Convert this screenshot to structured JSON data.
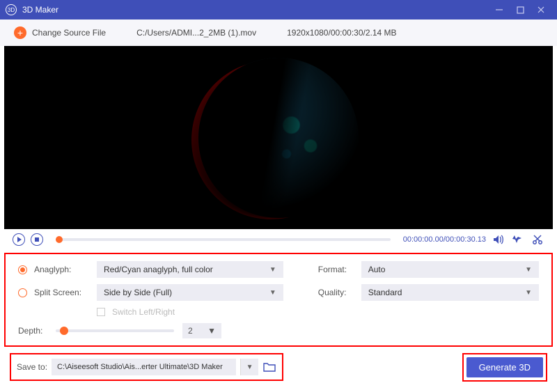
{
  "titlebar": {
    "title": "3D Maker"
  },
  "toolbar": {
    "change_label": "Change Source File",
    "path": "C:/Users/ADMI...2_2MB (1).mov",
    "info": "1920x1080/00:00:30/2.14 MB"
  },
  "playback": {
    "current": "00:00:00.00",
    "total": "/00:00:30.13"
  },
  "options": {
    "anaglyph_label": "Anaglyph:",
    "anaglyph_value": "Red/Cyan anaglyph, full color",
    "split_label": "Split Screen:",
    "split_value": "Side by Side (Full)",
    "switch_label": "Switch Left/Right",
    "depth_label": "Depth:",
    "depth_value": "2",
    "format_label": "Format:",
    "format_value": "Auto",
    "quality_label": "Quality:",
    "quality_value": "Standard"
  },
  "footer": {
    "save_label": "Save to:",
    "save_path": "C:\\Aiseesoft Studio\\Ais...erter Ultimate\\3D Maker",
    "generate": "Generate 3D"
  }
}
